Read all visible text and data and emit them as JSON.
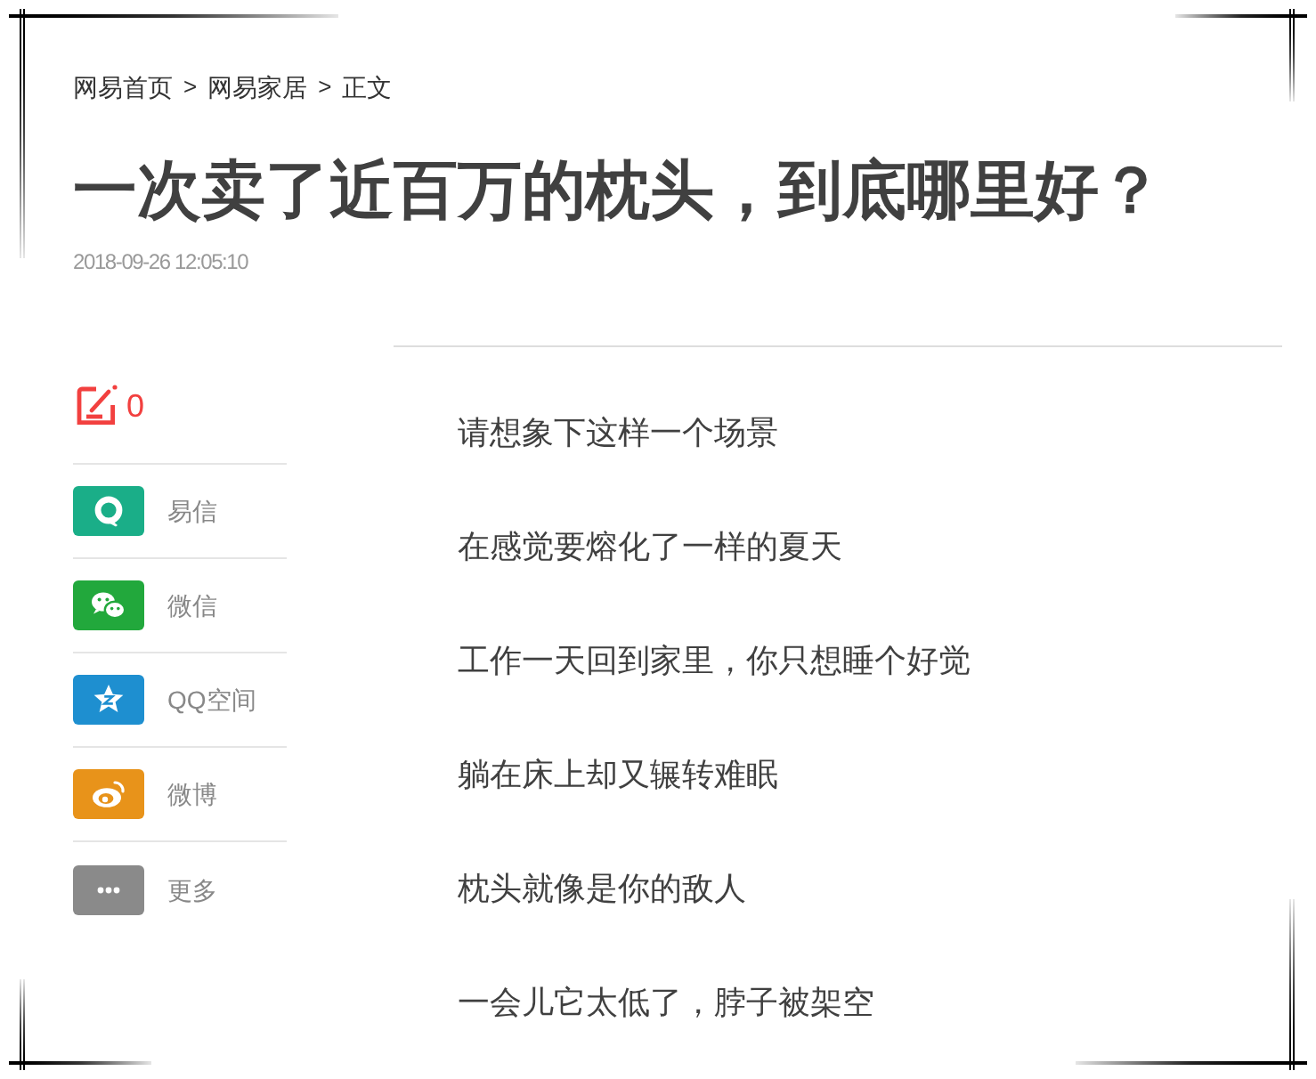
{
  "breadcrumb": [
    {
      "label": "网易首页"
    },
    {
      "separator": ">",
      "label": "网易家居"
    },
    {
      "separator": ">",
      "label": "正文"
    }
  ],
  "article": {
    "title": "一次卖了近百万的枕头，到底哪里好？",
    "date": "2018-09-26 12:05:10",
    "paragraphs": [
      "请想象下这样一个场景",
      "在感觉要熔化了一样的夏天",
      "工作一天回到家里，你只想睡个好觉",
      "躺在床上却又辗转难眠",
      "枕头就像是你的敌人",
      "一会儿它太低了，脖子被架空"
    ]
  },
  "sidebar": {
    "comments": {
      "count": "0"
    },
    "share": [
      {
        "kind": "yixin",
        "label": "易信",
        "color": "#1aae88"
      },
      {
        "kind": "weixin",
        "label": "微信",
        "color": "#22a83c"
      },
      {
        "kind": "qzone",
        "label": "QQ空间",
        "color": "#1e8fd0"
      },
      {
        "kind": "weibo",
        "label": "微博",
        "color": "#e8931a"
      },
      {
        "kind": "more",
        "label": "更多",
        "color": "#8a8a8a"
      }
    ]
  }
}
